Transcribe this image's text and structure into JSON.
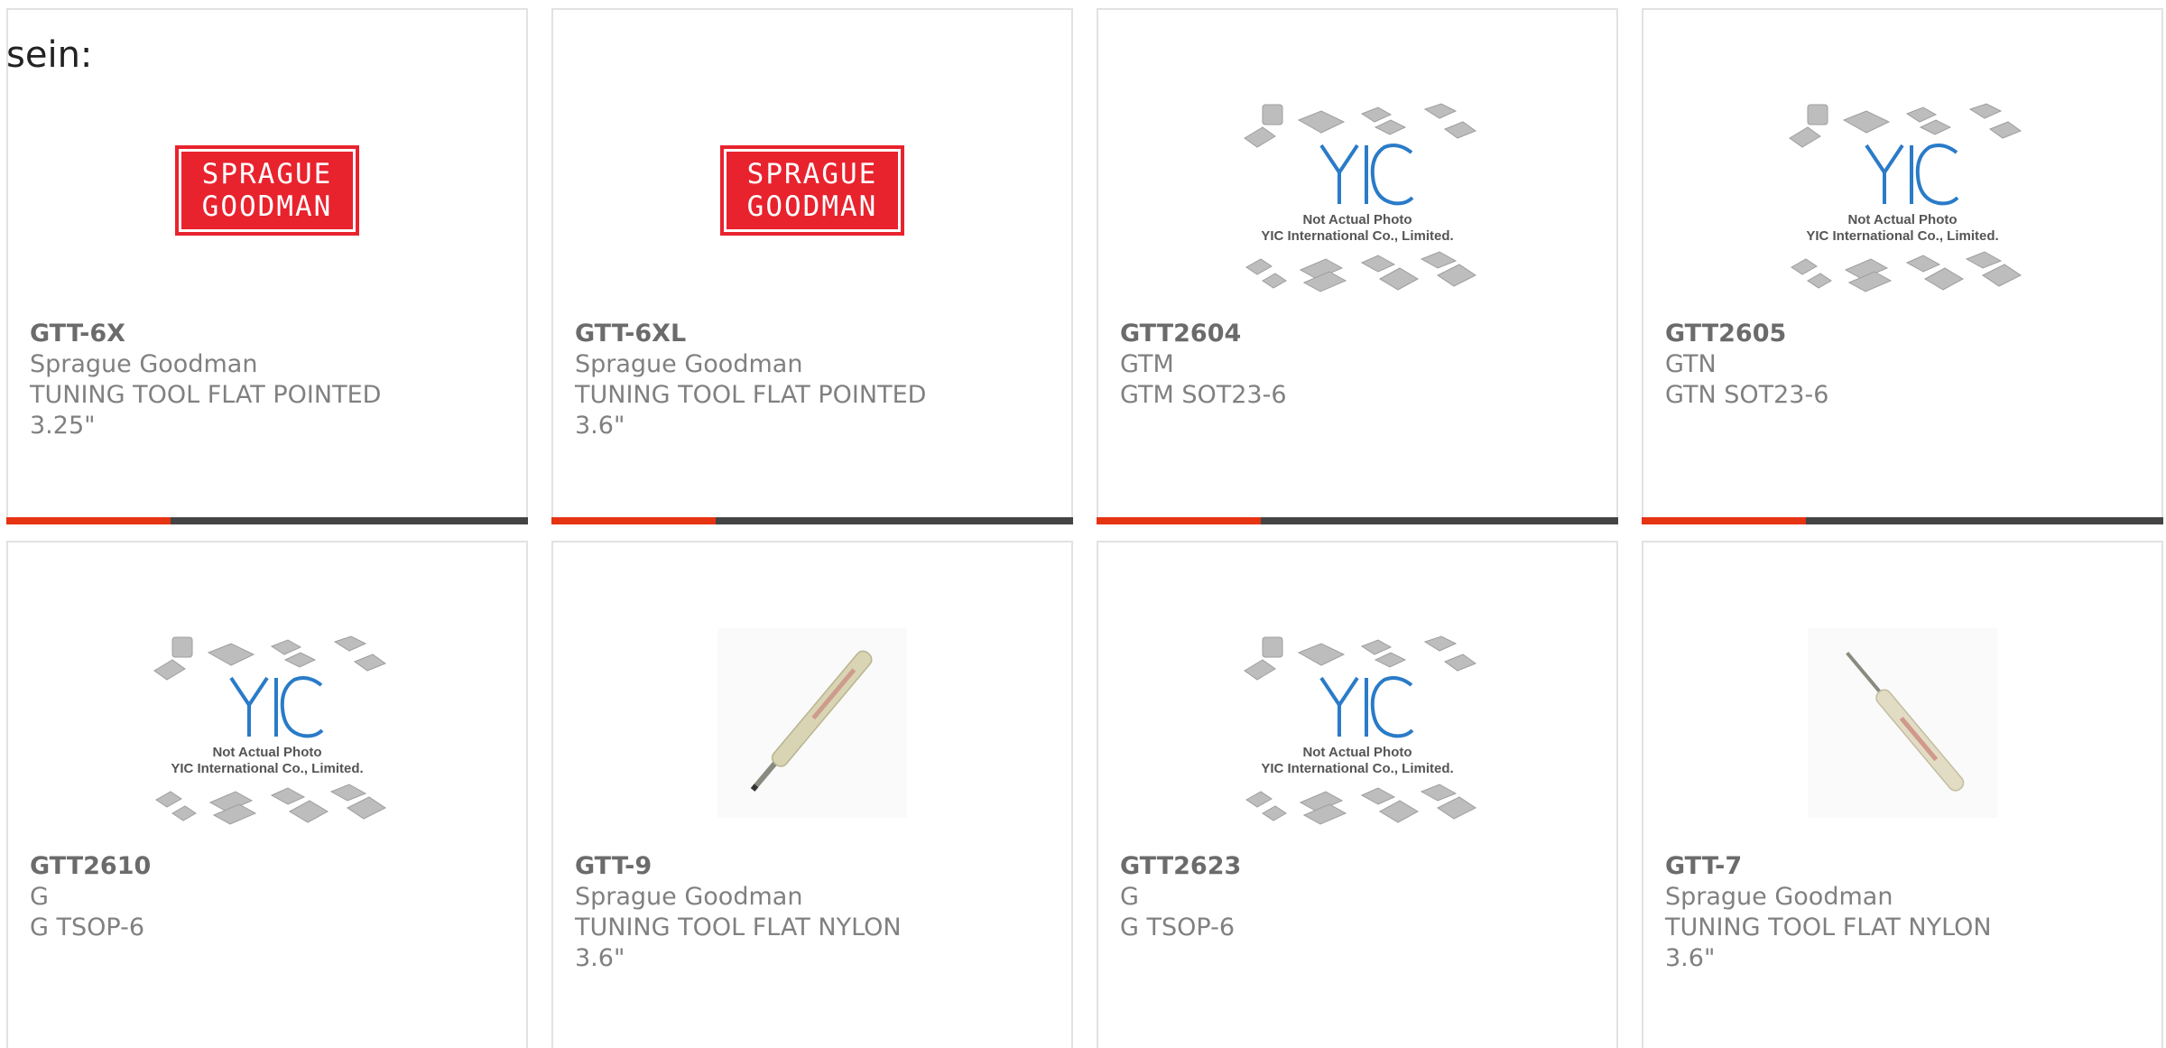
{
  "lead_text": "sein:",
  "accent_color": "#e63312",
  "bar_color": "#444444",
  "brand_logo": {
    "line1": "SPRAGUE",
    "line2": "GOODMAN",
    "color": "#e8232e"
  },
  "placeholder": {
    "logo_text": "YIC",
    "line1": "Not Actual Photo",
    "line2": "YIC International Co., Limited."
  },
  "products": [
    {
      "part": "GTT-6X",
      "manufacturer": "Sprague Goodman",
      "description": "TUNING TOOL FLAT POINTED 3.25\"",
      "image": "brand-logo"
    },
    {
      "part": "GTT-6XL",
      "manufacturer": "Sprague Goodman",
      "description": "TUNING TOOL FLAT POINTED 3.6\"",
      "image": "brand-logo"
    },
    {
      "part": "GTT2604",
      "manufacturer": "GTM",
      "description": "GTM SOT23-6",
      "image": "placeholder"
    },
    {
      "part": "GTT2605",
      "manufacturer": "GTN",
      "description": "GTN SOT23-6",
      "image": "placeholder"
    },
    {
      "part": "GTT2610",
      "manufacturer": "G",
      "description": "G TSOP-6",
      "image": "placeholder"
    },
    {
      "part": "GTT-9",
      "manufacturer": "Sprague Goodman",
      "description": "TUNING TOOL FLAT NYLON 3.6\"",
      "image": "tool-photo"
    },
    {
      "part": "GTT2623",
      "manufacturer": "G",
      "description": "G TSOP-6",
      "image": "placeholder"
    },
    {
      "part": "GTT-7",
      "manufacturer": "Sprague Goodman",
      "description": "TUNING TOOL FLAT NYLON 3.6\"",
      "image": "tool-photo"
    }
  ]
}
